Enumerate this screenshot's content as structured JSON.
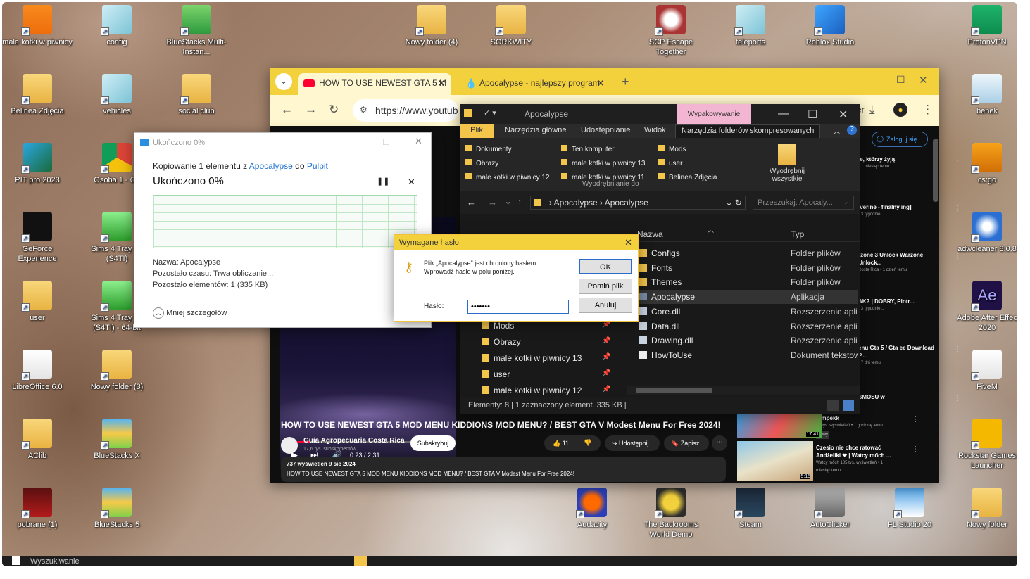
{
  "desktop": {
    "icons": [
      {
        "label": "male kotki w piwnicy",
        "icon": "vlc-icon",
        "style": "vlc"
      },
      {
        "label": "config",
        "icon": "document-icon",
        "style": "glass"
      },
      {
        "label": "BlueStacks Multi-Instan...",
        "icon": "bluestacks-icon",
        "style": "green"
      },
      {
        "label": "Belinea Zdjęcia",
        "icon": "folder-icon",
        "style": "folder"
      },
      {
        "label": "vehicles",
        "icon": "document-icon",
        "style": "glass"
      },
      {
        "label": "social club",
        "icon": "folder-icon",
        "style": "folder"
      },
      {
        "label": "PIT pro 2023",
        "icon": "pit-icon",
        "style": "blue"
      },
      {
        "label": "Osoba 1 - Ch",
        "icon": "chrome-icon",
        "style": "chrome"
      },
      {
        "label": "GeForce Experience",
        "icon": "nvidia-icon",
        "style": "nvidia"
      },
      {
        "label": "Sims 4 Tray Im (S4TI)",
        "icon": "sims-icon",
        "style": "sims"
      },
      {
        "label": "user",
        "icon": "folder-icon",
        "style": "folder"
      },
      {
        "label": "Sims 4 Tray Im (S4TI) - 64-bit",
        "icon": "sims-icon",
        "style": "sims"
      },
      {
        "label": "LibreOffice 6.0",
        "icon": "document-icon",
        "style": "doc"
      },
      {
        "label": "Nowy folder (3)",
        "icon": "folder-icon",
        "style": "folder"
      },
      {
        "label": "AClib",
        "icon": "folder-icon",
        "style": "folder"
      },
      {
        "label": "BlueStacks X",
        "icon": "bluestacks-icon",
        "style": "bs"
      },
      {
        "label": "pobrane (1)",
        "icon": "image-icon",
        "style": "red"
      },
      {
        "label": "BlueStacks 5",
        "icon": "bluestacks-icon",
        "style": "bs"
      },
      {
        "label": "Nowy folder (4)",
        "icon": "folder-icon",
        "style": "folder"
      },
      {
        "label": "SORKWITY",
        "icon": "folder-icon",
        "style": "folder"
      },
      {
        "label": "SCP Escape Together",
        "icon": "scp-icon",
        "style": "scp"
      },
      {
        "label": "teleports",
        "icon": "document-icon",
        "style": "glass"
      },
      {
        "label": "Roblox Studio",
        "icon": "roblox-icon",
        "style": "roblox"
      },
      {
        "label": "ProtonVPN",
        "icon": "protonvpn-icon",
        "style": "proton"
      },
      {
        "label": "benek",
        "icon": "recycle-bin-icon",
        "style": "bin"
      },
      {
        "label": "cs:go",
        "icon": "csgo-icon",
        "style": "csgo"
      },
      {
        "label": "adwcleaner 8.0.8",
        "icon": "adwcleaner-icon",
        "style": "adw"
      },
      {
        "label": "Adobe After Effec 2020",
        "icon": "after-effects-icon",
        "style": "ae"
      },
      {
        "label": "FiveM",
        "icon": "document-icon",
        "style": "doc"
      },
      {
        "label": "Rockstar Games Launcher",
        "icon": "rockstar-icon",
        "style": "rockstar"
      },
      {
        "label": "Nowy folder",
        "icon": "folder-icon",
        "style": "folder"
      },
      {
        "label": "Audacity",
        "icon": "audacity-icon",
        "style": "audacity"
      },
      {
        "label": "The Backrooms World Demo",
        "icon": "backrooms-icon",
        "style": "backrooms"
      },
      {
        "label": "Steam",
        "icon": "steam-icon",
        "style": "steam"
      },
      {
        "label": "AutoClicker",
        "icon": "mouse-icon",
        "style": "mouse"
      },
      {
        "label": "FL Studio 20",
        "icon": "flstudio-icon",
        "style": "fl"
      }
    ]
  },
  "chrome": {
    "tabs": [
      {
        "label": "HOW TO USE NEWEST GTA 5 M"
      },
      {
        "label": "Apocalypse - najlepszy program"
      }
    ],
    "new_tab": "+",
    "url": "https://www.youtub",
    "signin": "Zaloguj się",
    "video": {
      "time": "0:23 / 2:31",
      "progress": 0.15
    },
    "title": "HOW TO USE NEWEST GTA 5 MOD MENU KIDDIONS MOD MENU? / BEST GTA V Modest Menu For Free 2024!",
    "channel": "Guía Agropecuaria Costa Rica",
    "subs": "17,6 tys. subskrybentów",
    "subscribe": "Subskrybuj",
    "likes": "11",
    "share": "Udostępnij",
    "save": "Zapisz",
    "desc_stats": "737 wyświetleń  9 sie 2024",
    "desc_text": "HOW TO USE NEWEST GTA 5 MOD MENU KIDDIONS MOD MENU? / BEST GTA V Modest Menu For Free 2024!",
    "sidebar": [
      {
        "title": "ie, którzy żyją",
        "meta": "• 1 miesiąc temu"
      },
      {
        "title": "iverine - finalny ing]",
        "meta": "• 3 tygodnie..."
      },
      {
        "title": "rzone 3 Unlock Warzone Unlock...",
        "meta": "Costa Rica • 1 dzień temu"
      },
      {
        "title": "AK? | DOBRY, Piotr...",
        "meta": "• 3 tygodnie..."
      },
      {
        "title": "enu Gta 5 / Gta ee Download P...",
        "meta": "• 7 dni temu"
      },
      {
        "title": "SMOSU w",
        "meta": ""
      },
      {
        "title": "Pimpekk",
        "meta": "10 tys. wyświetleń • 1 godzinę temu",
        "badge": "Nowy",
        "dur": "17:41"
      },
      {
        "title": "Czesio nie chce ratować Andżeliki ❤ | Watcy mőch ...",
        "meta": "Watcy mőch 105 tys. wyświetleń • 1 miesiąc temu",
        "dur": "5:15"
      }
    ],
    "partial_label": "er"
  },
  "copy_dialog": {
    "title": "Ukończono 0%",
    "line_prefix": "Kopiowanie 1 elementu z",
    "source": "Apocalypse",
    "line_mid": "do",
    "dest": "Pulpit",
    "status": "Ukończono 0%",
    "name": "Nazwa: Apocalypse",
    "time_left": "Pozostało czasu: Trwa obliczanie...",
    "items_left": "Pozostało elementów: 1 (335 KB)",
    "fewer": "Mniej szczegółów",
    "progress": 0
  },
  "explorer": {
    "title": "Apocalypse",
    "context_tab": "Wypakowywanie",
    "tabs": [
      "Plik",
      "Narzędzia główne",
      "Udostępnianie",
      "Widok",
      "Narzędzia folderów skompresowanych"
    ],
    "ribbon": [
      "Dokumenty",
      "Ten komputer",
      "Mods",
      "Obrazy",
      "male kotki w piwnicy 13",
      "user",
      "male kotki w piwnicy 12",
      "male kotki w piwnicy 11",
      "Belinea Zdjęcia"
    ],
    "extract_all": "Wyodrębnij wszystkie",
    "extract_to": "Wyodrębnianie do",
    "breadcrumb": [
      "Apocalypse",
      "Apocalypse"
    ],
    "search_placeholder": "Przeszukaj: Apocaly...",
    "col_name": "Nazwa",
    "col_type": "Typ",
    "files": [
      {
        "name": "Configs",
        "type": "Folder plików",
        "icon": "folder"
      },
      {
        "name": "Fonts",
        "type": "Folder plików",
        "icon": "folder"
      },
      {
        "name": "Themes",
        "type": "Folder plików",
        "icon": "folder"
      },
      {
        "name": "Apocalypse",
        "type": "Aplikacja",
        "icon": "app"
      },
      {
        "name": "Core.dll",
        "type": "Rozszerzenie aplikacji",
        "icon": "dll"
      },
      {
        "name": "Data.dll",
        "type": "Rozszerzenie aplikacji",
        "icon": "dll"
      },
      {
        "name": "Drawing.dll",
        "type": "Rozszerzenie aplikacji",
        "icon": "dll"
      },
      {
        "name": "HowToUse",
        "type": "Dokument tekstowy",
        "icon": "txt"
      }
    ],
    "nav": [
      "Mods",
      "Obrazy",
      "male kotki w piwnicy 13",
      "user",
      "male kotki w piwnicy 12"
    ],
    "status": "Elementy: 8  |  1 zaznaczony element. 335 KB  |"
  },
  "password_dialog": {
    "title": "Wymagane hasło",
    "message": "Plik „Apocalypse\" jest chroniony hasłem. Wprowadź hasło w polu poniżej.",
    "label": "Hasło:",
    "value": "•••••••",
    "ok": "OK",
    "skip": "Pomiń plik",
    "cancel": "Anuluj"
  },
  "taskbar": {
    "search": "Wyszukiwanie"
  },
  "colors": {
    "accent": "#f3d13c",
    "link": "#1a6fd1",
    "yt_red": "#ff0033"
  }
}
